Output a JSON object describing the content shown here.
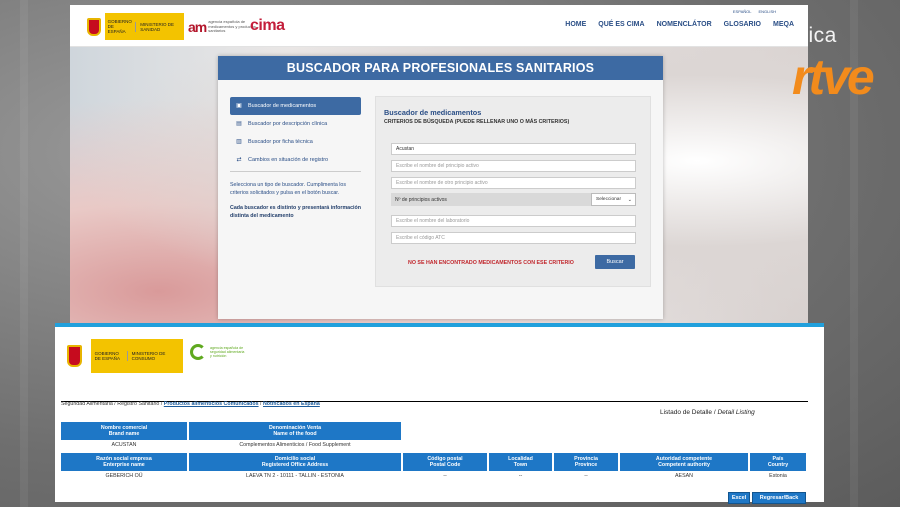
{
  "cima": {
    "gov_logo": {
      "line1": "GOBIERNO DE ESPAÑA",
      "line2": "MINISTERIO DE SANIDAD"
    },
    "aemps_text": "agencia española de medicamentos y productos sanitarios",
    "aemps_mark": "am",
    "cima_logo": "cima",
    "languages": [
      "ESPAÑOL",
      "ENGLISH"
    ],
    "nav": [
      "HOME",
      "QUÉ ES CIMA",
      "NOMENCLÁTOR",
      "GLOSARIO",
      "MEQA"
    ],
    "panel_title": "BUSCADOR PARA PROFESIONALES SANITARIOS",
    "menu": [
      {
        "label": "Buscador de medicamentos",
        "icon": "camera-icon",
        "glyph": "▣",
        "active": true
      },
      {
        "label": "Buscador por descripción clínica",
        "icon": "document-icon",
        "glyph": "▤",
        "active": false
      },
      {
        "label": "Buscador por ficha técnica",
        "icon": "file-icon",
        "glyph": "▥",
        "active": false
      },
      {
        "label": "Cambios en situación de registro",
        "icon": "exchange-icon",
        "glyph": "⇄",
        "active": false
      }
    ],
    "left_text": "Selecciona un tipo de buscador. Cumplimenta los criterios solicitados y pulsa en el botón buscar.",
    "left_text_bold": "Cada buscador es distinto y presentará información distinta del medicamento",
    "search": {
      "title": "Buscador de medicamentos",
      "subtitle": "CRITERIOS DE BÚSQUEDA (PUEDE RELLENAR UNO O MÁS CRITERIOS)",
      "name_value": "Acustan",
      "principio_placeholder": "Escribe el nombre del principio activo",
      "otro_principio_placeholder": "Escribe el nombre de otro principio activo",
      "count_label": "Nº de principios activos",
      "count_select": "Seleccionar",
      "lab_placeholder": "Escribe el nombre del laboratorio",
      "atc_placeholder": "Escribe el código ATC",
      "no_result": "NO SE HAN ENCONTRADO MEDICAMENTOS CON ESE CRITERIO",
      "button": "Buscar"
    }
  },
  "watermark": {
    "verifica": "Verifica",
    "rtve": "rtve"
  },
  "aesan": {
    "gov_logo": {
      "line1": "GOBIERNO DE ESPAÑA",
      "line2": "MINISTERIO DE CONSUMO"
    },
    "brand_text": "agencia española de seguridad alimentaria y nutrición",
    "breadcrumb": {
      "part1": "Seguridad Alimentaria",
      "part2": "Registro Sanitario",
      "part3": "Productos alimenticios Comunicados",
      "part4": "Notificados en España"
    },
    "listado": "Listado de Detalle",
    "listado_en": "Detail Listing",
    "table1": {
      "headers": [
        {
          "es": "Nombre comercial",
          "en": "Brand name"
        },
        {
          "es": "Denominación Venta",
          "en": "Name of the food"
        }
      ],
      "row": [
        "ACUSTAN",
        "Complementos Alimenticios / Food Supplement"
      ]
    },
    "table2": {
      "headers": [
        {
          "es": "Razón social empresa",
          "en": "Enterprise name"
        },
        {
          "es": "Domicilio social",
          "en": "Registered Office Address"
        },
        {
          "es": "Código postal",
          "en": "Postal Code"
        },
        {
          "es": "Localidad",
          "en": "Town"
        },
        {
          "es": "Provincia",
          "en": "Province"
        },
        {
          "es": "Autoridad competente",
          "en": "Competent authority"
        },
        {
          "es": "País",
          "en": "Country"
        }
      ],
      "row": [
        "GEBERICH OÜ",
        "LAEVA TN 2 - 10111 - TALLIN - ESTONIA",
        "--",
        "--",
        "--",
        "AESAN",
        "Estonia"
      ]
    },
    "buttons": {
      "excel": "Excel",
      "back": "Regresar/Back"
    }
  }
}
